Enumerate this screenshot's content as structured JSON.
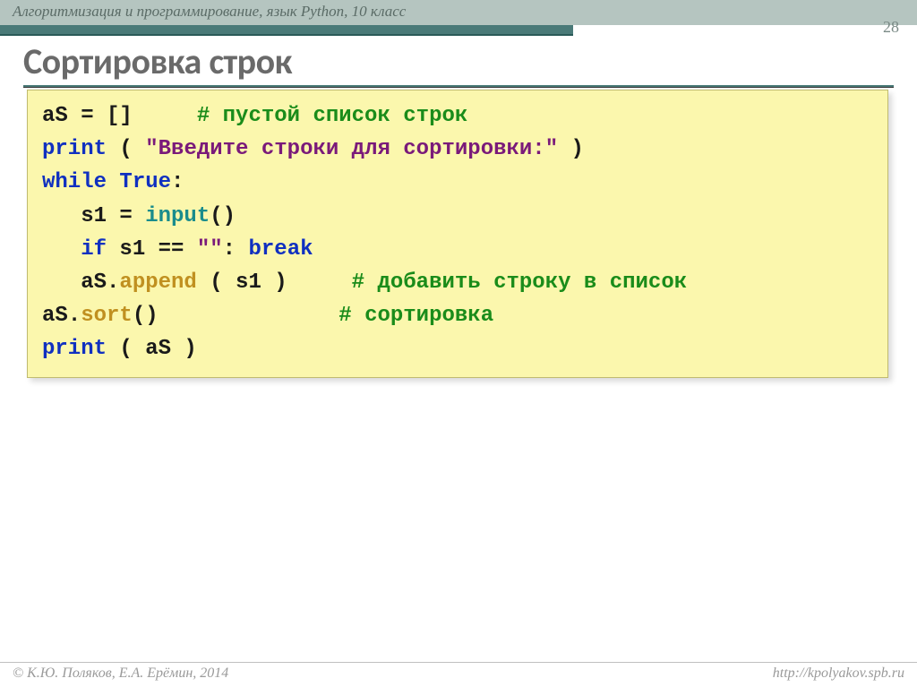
{
  "header": {
    "text": "Алгоритмизация и программирование, язык Python, 10 класс",
    "page_number": "28"
  },
  "title": "Сортировка строк",
  "code": {
    "l1_a": "aS = []     ",
    "l1_b": "# пустой список строк",
    "l2_a": "print",
    "l2_b": " ( ",
    "l2_c": "\"Введите строки для сортировки:\"",
    "l2_d": " )",
    "l3_a": "while",
    "l3_b": " ",
    "l3_c": "True",
    "l3_d": ":",
    "l4_a": "   s1 = ",
    "l4_b": "input",
    "l4_c": "()",
    "l5_a": "   ",
    "l5_b": "if",
    "l5_c": " s1 == ",
    "l5_d": "\"\"",
    "l5_e": ": ",
    "l5_f": "break",
    "l6_a": "   aS",
    "l6_b": ".",
    "l6_c": "append",
    "l6_d": " ( s1 )     ",
    "l6_e": "# добавить строку в список",
    "l7_a": "aS",
    "l7_b": ".",
    "l7_c": "sort",
    "l7_d": "()              ",
    "l7_e": "# сортировка",
    "l8_a": "print",
    "l8_b": " ( aS )"
  },
  "footer": {
    "left": "© К.Ю. Поляков, Е.А. Ерёмин, 2014",
    "right": "http://kpolyakov.spb.ru"
  }
}
